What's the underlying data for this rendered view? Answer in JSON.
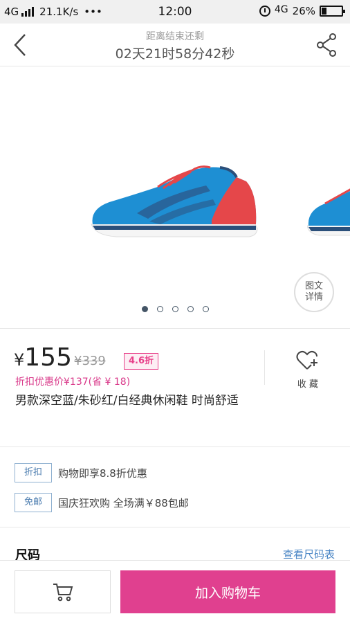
{
  "status_bar": {
    "network": "4G",
    "speed": "21.1K/s",
    "dots": "•••",
    "time": "12:00",
    "network_right": "4G",
    "battery": "26%",
    "battery_level": 0.26
  },
  "header": {
    "subtitle": "距离结束还剩",
    "countdown": "02天21时58分42秒",
    "back_icon": "chevron-left-icon",
    "share_icon": "share-icon"
  },
  "gallery": {
    "detail_button_line1": "图文",
    "detail_button_line2": "详情",
    "page_count": 5,
    "current_page": 1
  },
  "product": {
    "currency": "¥",
    "price": "155",
    "original_price": "¥339",
    "discount_badge": "4.6折",
    "promo_price": "折扣优惠价¥137(省 ¥ 18)",
    "title": "男款深空蓝/朱砂红/白经典休闲鞋 时尚舒适",
    "favorite_label": "收 藏"
  },
  "promotions": [
    {
      "tag": "折扣",
      "text": "购物即享8.8折优惠"
    },
    {
      "tag": "免邮",
      "text": "国庆狂欢购 全场满￥88包邮"
    }
  ],
  "size": {
    "title": "尺码",
    "chart_link": "查看尺码表"
  },
  "bottom_bar": {
    "cart_icon": "cart-icon",
    "add_to_cart": "加入购物车"
  },
  "colors": {
    "accent": "#e0408f",
    "link": "#4a86c5",
    "tag_border": "#8fb0d0"
  }
}
